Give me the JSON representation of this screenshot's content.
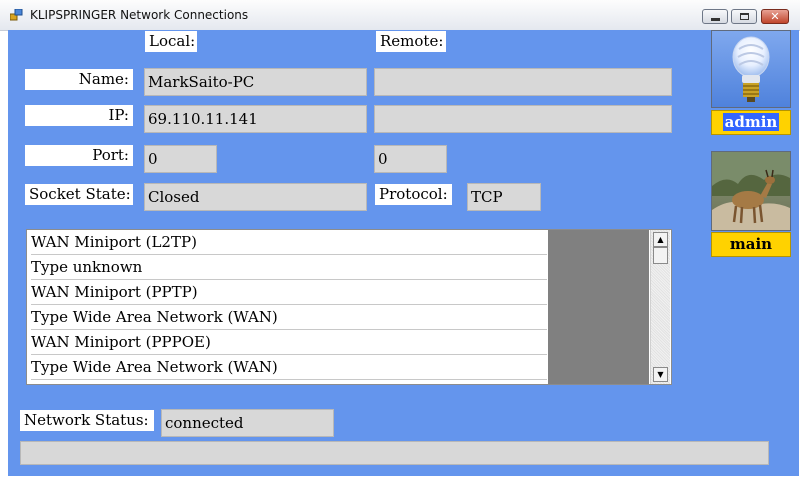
{
  "window": {
    "title": "KLIPSPRINGER Network Connections",
    "minimize_icon": "minimize-icon",
    "maximize_icon": "maximize-icon",
    "close_icon": "close-icon"
  },
  "headers": {
    "local": "Local:",
    "remote": "Remote:"
  },
  "fields": {
    "name_label": "Name:",
    "name_local": "MarkSaito-PC",
    "name_remote": "",
    "ip_label": "IP:",
    "ip_local": "69.110.11.141",
    "ip_remote": "",
    "port_label": "Port:",
    "port_local": "0",
    "port_remote": "0",
    "socket_state_label": "Socket State:",
    "socket_state": "Closed",
    "protocol_label": "Protocol:",
    "protocol": "TCP"
  },
  "connections_list": [
    "WAN Miniport (L2TP)",
    "Type unknown",
    "WAN Miniport (PPTP)",
    "Type Wide Area Network (WAN)",
    "WAN Miniport (PPPOE)",
    "Type Wide Area Network (WAN)"
  ],
  "side_panel": {
    "admin_label": "admin",
    "main_label": "main",
    "admin_image_icon": "light-bulb-icon",
    "main_image_icon": "antelope-photo"
  },
  "status": {
    "label": "Network Status:",
    "value": "connected",
    "progress_fraction": 0
  },
  "colors": {
    "client_background": "#6495ed",
    "label_highlight": "#ffd200",
    "selection": "#3366ff"
  }
}
